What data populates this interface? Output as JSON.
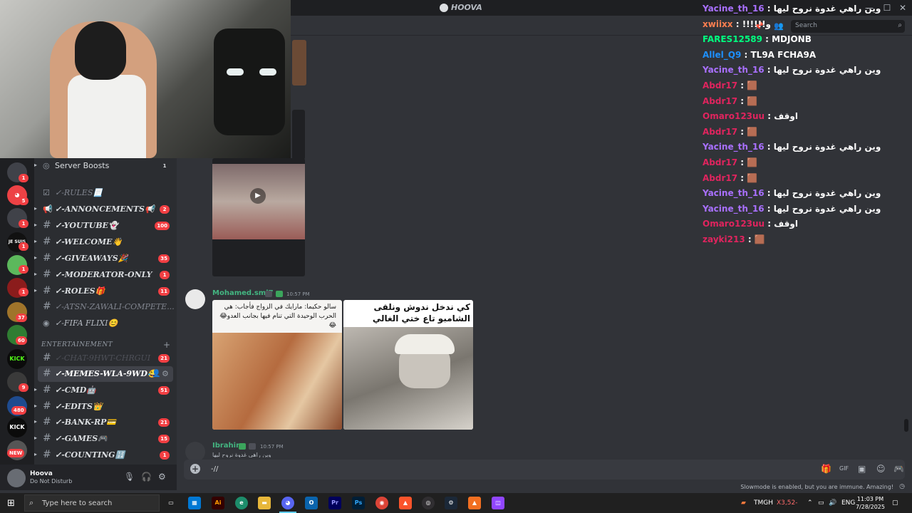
{
  "window": {
    "app_title": "HOOVA",
    "minimize": "—",
    "maximize": "☐",
    "close": "✕"
  },
  "header": {
    "search_placeholder": "Search"
  },
  "channels": {
    "server_boosts": {
      "label": "Server Boosts",
      "count": "1"
    },
    "items": [
      {
        "label": "✓-RULES📃",
        "badge": ""
      },
      {
        "label": "✓-ANNONCEMENTS📢",
        "badge": "2"
      },
      {
        "label": "✓-YOUTUBE👻",
        "badge": "100"
      },
      {
        "label": "✓-WELCOME👋",
        "badge": ""
      },
      {
        "label": "✓-GIVEAWAYS🎉",
        "badge": "35"
      },
      {
        "label": "✓-MODERATOR-ONLY",
        "badge": "1"
      },
      {
        "label": "✓-ROLES🎁",
        "badge": "11"
      },
      {
        "label": "✓-ATSN-ZAWALI-COMPETE...",
        "badge": ""
      },
      {
        "label": "✓-FIFA FLIXI😊",
        "badge": ""
      }
    ],
    "category": "ENTERTAINEMENT",
    "category_items": [
      {
        "label": "✓-CHAT-9HWT-CHRGUI",
        "badge": "21"
      },
      {
        "label": "✓-MEMES-WLA-9WD😂",
        "badge": ""
      },
      {
        "label": "✓-CMD🤖",
        "badge": "51"
      },
      {
        "label": "✓-EDITS👑",
        "badge": ""
      },
      {
        "label": "✓-BANK-RP💳",
        "badge": "21"
      },
      {
        "label": "✓-GAMES🎮",
        "badge": "15"
      },
      {
        "label": "✓-COUNTING🔢",
        "badge": "1"
      }
    ]
  },
  "servers": {
    "badges": [
      "1",
      "5",
      "1",
      "1",
      "1",
      "1",
      "37",
      "60",
      "9",
      "480"
    ],
    "kick_label": "KICK",
    "new_label": "NEW",
    "je_suis": "JE SUIS"
  },
  "user": {
    "name": "Hoova",
    "status": "Do Not Disturb"
  },
  "messages": [
    {
      "author": "Mohamed.sml7",
      "time": "10:57 PM",
      "author_color": "#43b581"
    },
    {
      "author": "Ibrahim",
      "time": "10:57 PM",
      "author_color": "#43b581",
      "preview": "وين راهي غدوة نروح ليها"
    }
  ],
  "memes": {
    "left_caption": "سالو حكيما: مارايك في الزواج فأجاب: هي الحرب الوحيدة التي تنام فيها بجانب العدو😂😂",
    "right_caption": "كي ندخل ندوش ونلقى الشامبو تاع ختي الغالي"
  },
  "composer": {
    "value": "-//",
    "slowmode": "Slowmode is enabled, but you are immune. Amazing!"
  },
  "livechat": [
    {
      "user": "Yacine_th_16",
      "color": "#a970ff",
      "msg": "وين راهي غدوة نروح ليها"
    },
    {
      "user": "xwiixx",
      "color": "#ff7f50",
      "msg": "!!!!!!و"
    },
    {
      "user": "FARES12589",
      "color": "#00ff7f",
      "msg": "MDJONB"
    },
    {
      "user": "Allel_Q9",
      "color": "#1e90ff",
      "msg": "TL9A FCHA9A"
    },
    {
      "user": "Yacine_th_16",
      "color": "#a970ff",
      "msg": "وين راهي غدوة نروح ليها"
    },
    {
      "user": "Abdr17",
      "color": "#e0245e",
      "msg": "🟫"
    },
    {
      "user": "Abdr17",
      "color": "#e0245e",
      "msg": "🟫"
    },
    {
      "user": "Omaro123uu",
      "color": "#e0245e",
      "msg": "اوقف"
    },
    {
      "user": "Abdr17",
      "color": "#e0245e",
      "msg": "🟫"
    },
    {
      "user": "Yacine_th_16",
      "color": "#a970ff",
      "msg": "وين راهي غدوة نروح ليها"
    },
    {
      "user": "Abdr17",
      "color": "#e0245e",
      "msg": "🟫"
    },
    {
      "user": "Abdr17",
      "color": "#e0245e",
      "msg": "🟫"
    },
    {
      "user": "Yacine_th_16",
      "color": "#a970ff",
      "msg": "وين راهي غدوة نروح ليها"
    },
    {
      "user": "Yacine_th_16",
      "color": "#a970ff",
      "msg": "وين راهي غدوة نروح ليها"
    },
    {
      "user": "Omaro123uu",
      "color": "#e0245e",
      "msg": "اوقف"
    },
    {
      "user": "zayki213",
      "color": "#e0245e",
      "msg": "🟫"
    }
  ],
  "taskbar": {
    "search_placeholder": "Type here to search",
    "weather_label": "TMGH",
    "weather_value": "X3,52-",
    "lang": "ENG",
    "time": "11:03 PM",
    "date": "7/28/2025"
  }
}
